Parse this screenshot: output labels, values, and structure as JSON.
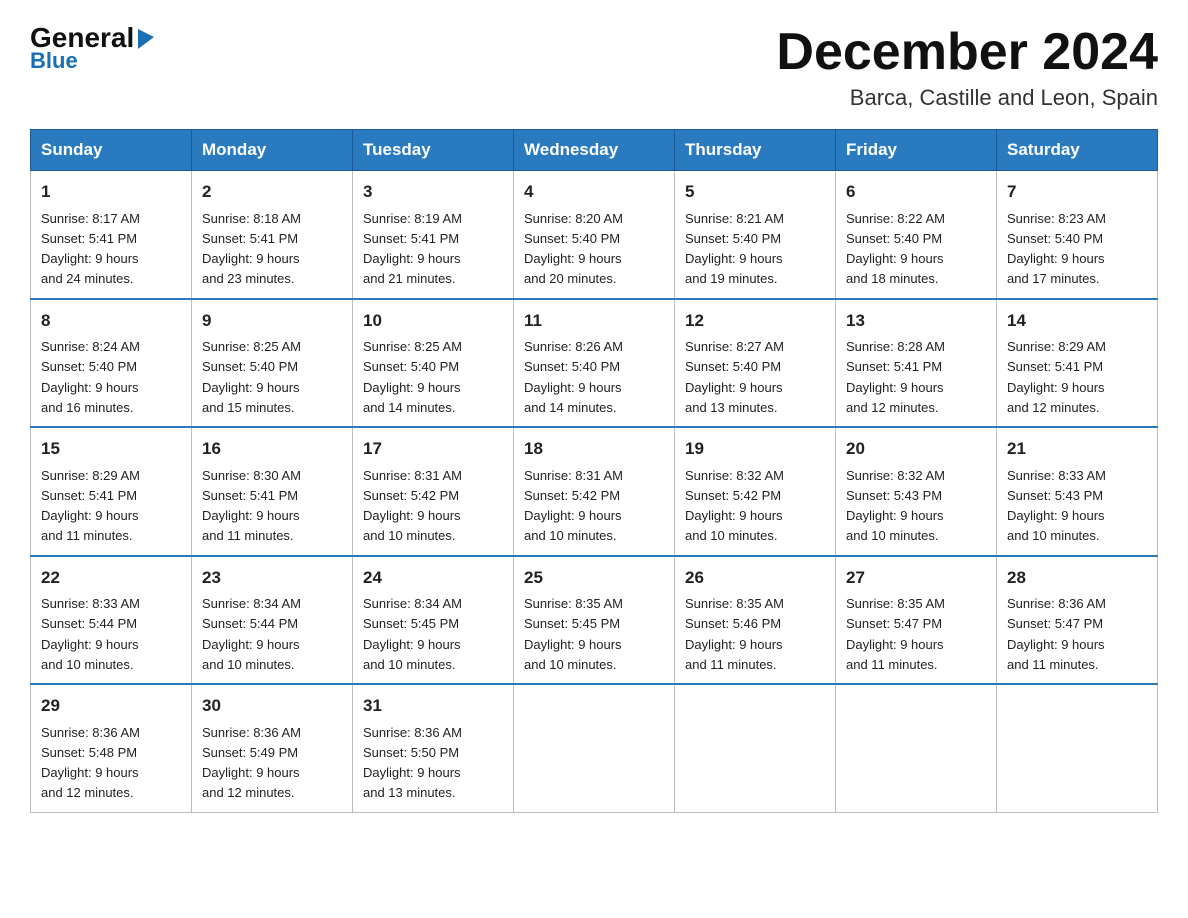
{
  "logo": {
    "general": "General",
    "blue": "Blue",
    "triangle_alt": "▶"
  },
  "header": {
    "month_year": "December 2024",
    "location": "Barca, Castille and Leon, Spain"
  },
  "weekdays": [
    "Sunday",
    "Monday",
    "Tuesday",
    "Wednesday",
    "Thursday",
    "Friday",
    "Saturday"
  ],
  "weeks": [
    [
      {
        "day": "1",
        "sunrise": "8:17 AM",
        "sunset": "5:41 PM",
        "daylight": "9 hours and 24 minutes."
      },
      {
        "day": "2",
        "sunrise": "8:18 AM",
        "sunset": "5:41 PM",
        "daylight": "9 hours and 23 minutes."
      },
      {
        "day": "3",
        "sunrise": "8:19 AM",
        "sunset": "5:41 PM",
        "daylight": "9 hours and 21 minutes."
      },
      {
        "day": "4",
        "sunrise": "8:20 AM",
        "sunset": "5:40 PM",
        "daylight": "9 hours and 20 minutes."
      },
      {
        "day": "5",
        "sunrise": "8:21 AM",
        "sunset": "5:40 PM",
        "daylight": "9 hours and 19 minutes."
      },
      {
        "day": "6",
        "sunrise": "8:22 AM",
        "sunset": "5:40 PM",
        "daylight": "9 hours and 18 minutes."
      },
      {
        "day": "7",
        "sunrise": "8:23 AM",
        "sunset": "5:40 PM",
        "daylight": "9 hours and 17 minutes."
      }
    ],
    [
      {
        "day": "8",
        "sunrise": "8:24 AM",
        "sunset": "5:40 PM",
        "daylight": "9 hours and 16 minutes."
      },
      {
        "day": "9",
        "sunrise": "8:25 AM",
        "sunset": "5:40 PM",
        "daylight": "9 hours and 15 minutes."
      },
      {
        "day": "10",
        "sunrise": "8:25 AM",
        "sunset": "5:40 PM",
        "daylight": "9 hours and 14 minutes."
      },
      {
        "day": "11",
        "sunrise": "8:26 AM",
        "sunset": "5:40 PM",
        "daylight": "9 hours and 14 minutes."
      },
      {
        "day": "12",
        "sunrise": "8:27 AM",
        "sunset": "5:40 PM",
        "daylight": "9 hours and 13 minutes."
      },
      {
        "day": "13",
        "sunrise": "8:28 AM",
        "sunset": "5:41 PM",
        "daylight": "9 hours and 12 minutes."
      },
      {
        "day": "14",
        "sunrise": "8:29 AM",
        "sunset": "5:41 PM",
        "daylight": "9 hours and 12 minutes."
      }
    ],
    [
      {
        "day": "15",
        "sunrise": "8:29 AM",
        "sunset": "5:41 PM",
        "daylight": "9 hours and 11 minutes."
      },
      {
        "day": "16",
        "sunrise": "8:30 AM",
        "sunset": "5:41 PM",
        "daylight": "9 hours and 11 minutes."
      },
      {
        "day": "17",
        "sunrise": "8:31 AM",
        "sunset": "5:42 PM",
        "daylight": "9 hours and 10 minutes."
      },
      {
        "day": "18",
        "sunrise": "8:31 AM",
        "sunset": "5:42 PM",
        "daylight": "9 hours and 10 minutes."
      },
      {
        "day": "19",
        "sunrise": "8:32 AM",
        "sunset": "5:42 PM",
        "daylight": "9 hours and 10 minutes."
      },
      {
        "day": "20",
        "sunrise": "8:32 AM",
        "sunset": "5:43 PM",
        "daylight": "9 hours and 10 minutes."
      },
      {
        "day": "21",
        "sunrise": "8:33 AM",
        "sunset": "5:43 PM",
        "daylight": "9 hours and 10 minutes."
      }
    ],
    [
      {
        "day": "22",
        "sunrise": "8:33 AM",
        "sunset": "5:44 PM",
        "daylight": "9 hours and 10 minutes."
      },
      {
        "day": "23",
        "sunrise": "8:34 AM",
        "sunset": "5:44 PM",
        "daylight": "9 hours and 10 minutes."
      },
      {
        "day": "24",
        "sunrise": "8:34 AM",
        "sunset": "5:45 PM",
        "daylight": "9 hours and 10 minutes."
      },
      {
        "day": "25",
        "sunrise": "8:35 AM",
        "sunset": "5:45 PM",
        "daylight": "9 hours and 10 minutes."
      },
      {
        "day": "26",
        "sunrise": "8:35 AM",
        "sunset": "5:46 PM",
        "daylight": "9 hours and 11 minutes."
      },
      {
        "day": "27",
        "sunrise": "8:35 AM",
        "sunset": "5:47 PM",
        "daylight": "9 hours and 11 minutes."
      },
      {
        "day": "28",
        "sunrise": "8:36 AM",
        "sunset": "5:47 PM",
        "daylight": "9 hours and 11 minutes."
      }
    ],
    [
      {
        "day": "29",
        "sunrise": "8:36 AM",
        "sunset": "5:48 PM",
        "daylight": "9 hours and 12 minutes."
      },
      {
        "day": "30",
        "sunrise": "8:36 AM",
        "sunset": "5:49 PM",
        "daylight": "9 hours and 12 minutes."
      },
      {
        "day": "31",
        "sunrise": "8:36 AM",
        "sunset": "5:50 PM",
        "daylight": "9 hours and 13 minutes."
      },
      null,
      null,
      null,
      null
    ]
  ],
  "labels": {
    "sunrise": "Sunrise:",
    "sunset": "Sunset:",
    "daylight": "Daylight:"
  }
}
